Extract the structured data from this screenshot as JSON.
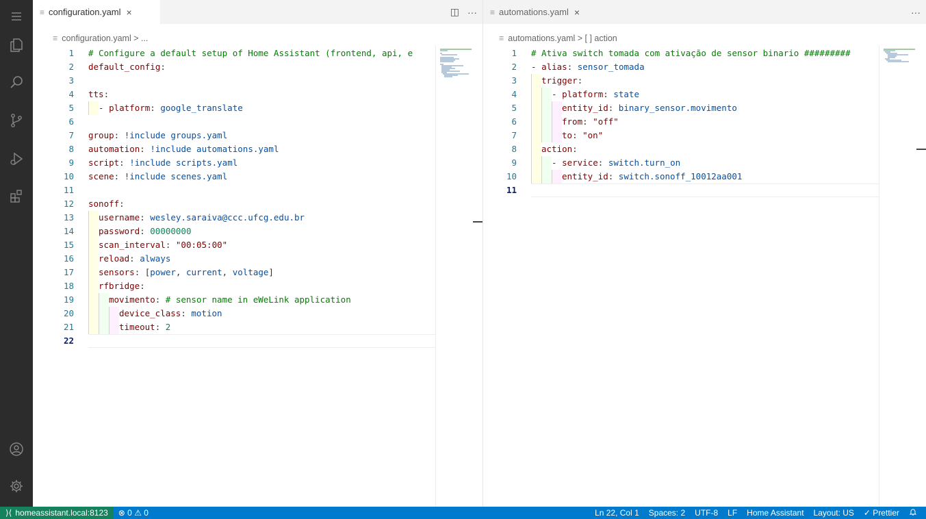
{
  "activity_bar": {
    "icons": [
      "menu-icon",
      "explorer-icon",
      "search-icon",
      "source-control-icon",
      "run-debug-icon",
      "extensions-icon",
      "account-icon",
      "settings-gear-icon"
    ]
  },
  "left_editor": {
    "tab_label": "configuration.yaml",
    "tab_close": "×",
    "split_icon": "◫",
    "more_icon": "···",
    "breadcrumb": "configuration.yaml > ...",
    "current_line": "22"
  },
  "right_editor": {
    "tab_label": "automations.yaml",
    "tab_close": "×",
    "more_icon": "···",
    "breadcrumb": "automations.yaml > [ ] action",
    "current_line": "11"
  },
  "left_lines": [
    {
      "n": "1",
      "segs": [
        {
          "t": "# Configure a default setup of Home Assistant (frontend, api, e",
          "c": "c"
        }
      ]
    },
    {
      "n": "2",
      "segs": [
        {
          "t": "default_config",
          "c": "k"
        },
        {
          "t": ":",
          "c": "p"
        }
      ]
    },
    {
      "n": "3",
      "segs": []
    },
    {
      "n": "4",
      "segs": [
        {
          "t": "tts",
          "c": "k"
        },
        {
          "t": ":",
          "c": "p"
        }
      ]
    },
    {
      "n": "5",
      "ind": 1,
      "segs": [
        {
          "t": "- ",
          "c": "p"
        },
        {
          "t": "platform",
          "c": "k"
        },
        {
          "t": ": ",
          "c": "p"
        },
        {
          "t": "google_translate",
          "c": "s"
        }
      ]
    },
    {
      "n": "6",
      "segs": []
    },
    {
      "n": "7",
      "segs": [
        {
          "t": "group",
          "c": "k"
        },
        {
          "t": ": ",
          "c": "p"
        },
        {
          "t": "!include groups.yaml",
          "c": "s"
        }
      ]
    },
    {
      "n": "8",
      "segs": [
        {
          "t": "automation",
          "c": "k"
        },
        {
          "t": ": ",
          "c": "p"
        },
        {
          "t": "!include automations.yaml",
          "c": "s"
        }
      ]
    },
    {
      "n": "9",
      "segs": [
        {
          "t": "script",
          "c": "k"
        },
        {
          "t": ": ",
          "c": "p"
        },
        {
          "t": "!include scripts.yaml",
          "c": "s"
        }
      ]
    },
    {
      "n": "10",
      "segs": [
        {
          "t": "scene",
          "c": "k"
        },
        {
          "t": ": ",
          "c": "p"
        },
        {
          "t": "!include scenes.yaml",
          "c": "s"
        }
      ]
    },
    {
      "n": "11",
      "segs": []
    },
    {
      "n": "12",
      "segs": [
        {
          "t": "sonoff",
          "c": "k"
        },
        {
          "t": ":",
          "c": "p"
        }
      ]
    },
    {
      "n": "13",
      "ind": 1,
      "segs": [
        {
          "t": "username",
          "c": "k"
        },
        {
          "t": ": ",
          "c": "p"
        },
        {
          "t": "wesley.saraiva@ccc.ufcg.edu.br",
          "c": "s"
        }
      ]
    },
    {
      "n": "14",
      "ind": 1,
      "segs": [
        {
          "t": "password",
          "c": "k"
        },
        {
          "t": ": ",
          "c": "p"
        },
        {
          "t": "00000000",
          "c": "n"
        }
      ]
    },
    {
      "n": "15",
      "ind": 1,
      "segs": [
        {
          "t": "scan_interval",
          "c": "k"
        },
        {
          "t": ": ",
          "c": "p"
        },
        {
          "t": "\"00:05:00\"",
          "c": "k"
        }
      ]
    },
    {
      "n": "16",
      "ind": 1,
      "segs": [
        {
          "t": "reload",
          "c": "k"
        },
        {
          "t": ": ",
          "c": "p"
        },
        {
          "t": "always",
          "c": "s"
        }
      ]
    },
    {
      "n": "17",
      "ind": 1,
      "segs": [
        {
          "t": "sensors",
          "c": "k"
        },
        {
          "t": ": [",
          "c": "p"
        },
        {
          "t": "power",
          "c": "s"
        },
        {
          "t": ", ",
          "c": "p"
        },
        {
          "t": "current",
          "c": "s"
        },
        {
          "t": ", ",
          "c": "p"
        },
        {
          "t": "voltage",
          "c": "s"
        },
        {
          "t": "]",
          "c": "p"
        }
      ]
    },
    {
      "n": "18",
      "ind": 1,
      "segs": [
        {
          "t": "rfbridge",
          "c": "k"
        },
        {
          "t": ":",
          "c": "p"
        }
      ]
    },
    {
      "n": "19",
      "ind": 2,
      "segs": [
        {
          "t": "movimento",
          "c": "k"
        },
        {
          "t": ": ",
          "c": "p"
        },
        {
          "t": "# sensor name in eWeLink application",
          "c": "c"
        }
      ]
    },
    {
      "n": "20",
      "ind": 3,
      "segs": [
        {
          "t": "device_class",
          "c": "k"
        },
        {
          "t": ": ",
          "c": "p"
        },
        {
          "t": "motion",
          "c": "s"
        }
      ]
    },
    {
      "n": "21",
      "ind": 3,
      "segs": [
        {
          "t": "timeout",
          "c": "k"
        },
        {
          "t": ": ",
          "c": "p"
        },
        {
          "t": "2",
          "c": "n"
        }
      ]
    },
    {
      "n": "22",
      "segs": []
    }
  ],
  "right_lines": [
    {
      "n": "1",
      "segs": [
        {
          "t": "# Ativa switch tomada com ativação de sensor binario #########",
          "c": "c"
        }
      ]
    },
    {
      "n": "2",
      "segs": [
        {
          "t": "- ",
          "c": "p"
        },
        {
          "t": "alias",
          "c": "k"
        },
        {
          "t": ": ",
          "c": "p"
        },
        {
          "t": "sensor_tomada",
          "c": "s"
        }
      ]
    },
    {
      "n": "3",
      "ind": 1,
      "segs": [
        {
          "t": "trigger",
          "c": "k"
        },
        {
          "t": ":",
          "c": "p"
        }
      ]
    },
    {
      "n": "4",
      "ind": 2,
      "segs": [
        {
          "t": "- ",
          "c": "p"
        },
        {
          "t": "platform",
          "c": "k"
        },
        {
          "t": ": ",
          "c": "p"
        },
        {
          "t": "state",
          "c": "s"
        }
      ]
    },
    {
      "n": "5",
      "ind": 3,
      "segs": [
        {
          "t": "entity_id",
          "c": "k"
        },
        {
          "t": ": ",
          "c": "p"
        },
        {
          "t": "binary_sensor.movimento",
          "c": "s"
        }
      ]
    },
    {
      "n": "6",
      "ind": 3,
      "segs": [
        {
          "t": "from",
          "c": "k"
        },
        {
          "t": ": ",
          "c": "p"
        },
        {
          "t": "\"off\"",
          "c": "k"
        }
      ]
    },
    {
      "n": "7",
      "ind": 3,
      "segs": [
        {
          "t": "to",
          "c": "k"
        },
        {
          "t": ": ",
          "c": "p"
        },
        {
          "t": "\"on\"",
          "c": "k"
        }
      ]
    },
    {
      "n": "8",
      "ind": 1,
      "segs": [
        {
          "t": "action",
          "c": "k"
        },
        {
          "t": ":",
          "c": "p"
        }
      ]
    },
    {
      "n": "9",
      "ind": 2,
      "segs": [
        {
          "t": "- ",
          "c": "p"
        },
        {
          "t": "service",
          "c": "k"
        },
        {
          "t": ": ",
          "c": "p"
        },
        {
          "t": "switch.turn_on",
          "c": "s"
        }
      ]
    },
    {
      "n": "10",
      "ind": 3,
      "segs": [
        {
          "t": "entity_id",
          "c": "k"
        },
        {
          "t": ": ",
          "c": "p"
        },
        {
          "t": "switch.sonoff_10012aa001",
          "c": "s"
        }
      ]
    },
    {
      "n": "11",
      "segs": []
    }
  ],
  "statusbar": {
    "remote": "homeassistant.local:8123",
    "problems": "⊗ 0 ⚠ 0",
    "cursor": "Ln 22, Col 1",
    "spaces": "Spaces: 2",
    "encoding": "UTF-8",
    "eol": "LF",
    "language": "Home Assistant",
    "layout": "Layout: US",
    "prettier": "✓ Prettier",
    "bell": "🔔"
  }
}
